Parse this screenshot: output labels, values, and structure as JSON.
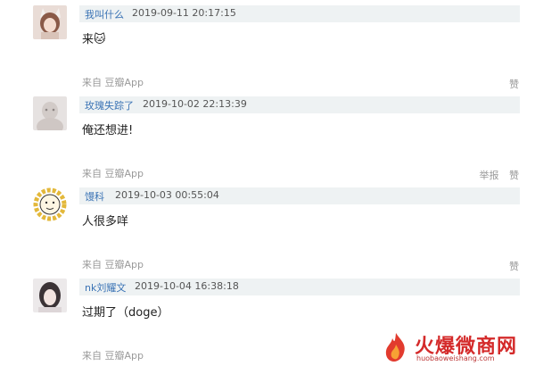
{
  "comments": [
    {
      "username": "我叫什么",
      "timestamp": "2019-09-11 20:17:15",
      "content": "来🐱",
      "source": "来自 豆瓣App",
      "actions": [
        "赞"
      ],
      "avatar_icon": "cat-girl-avatar"
    },
    {
      "username": "玫瑰失踪了",
      "timestamp": "2019-10-02 22:13:39",
      "content": "俺还想进!",
      "source": "来自 豆瓣App",
      "actions": [
        "举报",
        "赞"
      ],
      "avatar_icon": "blurry-photo-avatar"
    },
    {
      "username": "馒科",
      "timestamp": "2019-10-03 00:55:04",
      "content": "人很多咩",
      "source": "来自 豆瓣App",
      "actions": [
        "赞"
      ],
      "avatar_icon": "lion-cartoon-avatar"
    },
    {
      "username": "nk刘耀文",
      "timestamp": "2019-10-04 16:38:18",
      "content": "过期了（doge）",
      "source": "来自 豆瓣App",
      "actions": [],
      "avatar_icon": "girl-photo-avatar"
    }
  ],
  "watermark": {
    "text": "火爆微商网",
    "url": "huobaoweishang.com"
  },
  "colors": {
    "username": "#3a73b5",
    "meta_bar": "#eef2f3",
    "watermark": "#d42a2a"
  }
}
